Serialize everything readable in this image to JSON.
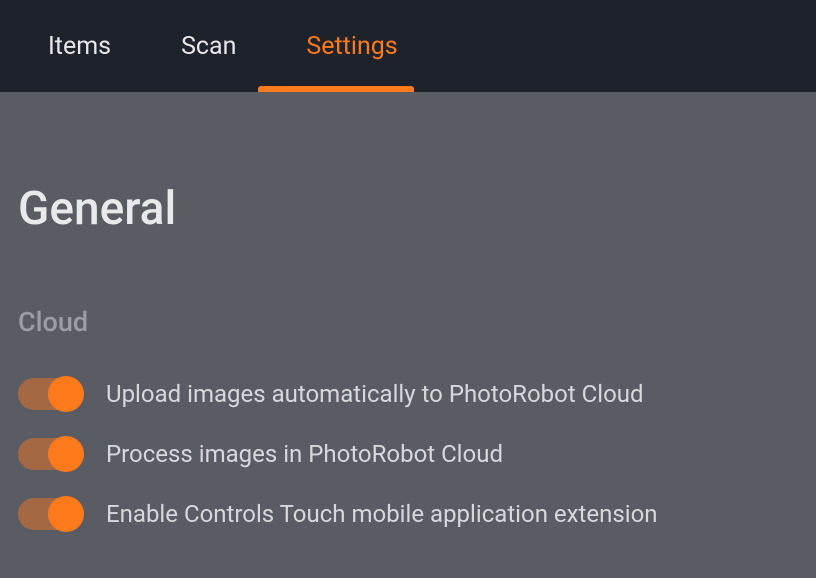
{
  "tabs": {
    "items": "Items",
    "scan": "Scan",
    "settings": "Settings"
  },
  "page": {
    "title": "General"
  },
  "sections": {
    "cloud": {
      "title": "Cloud",
      "toggles": [
        {
          "label": "Upload images automatically to PhotoRobot Cloud",
          "on": true
        },
        {
          "label": "Process images in PhotoRobot Cloud",
          "on": true
        },
        {
          "label": "Enable Controls Touch mobile application extension",
          "on": true
        }
      ]
    }
  },
  "colors": {
    "accent": "#ff7a1a",
    "tabbar_bg": "#1e222b",
    "content_bg": "#5a5c64"
  }
}
